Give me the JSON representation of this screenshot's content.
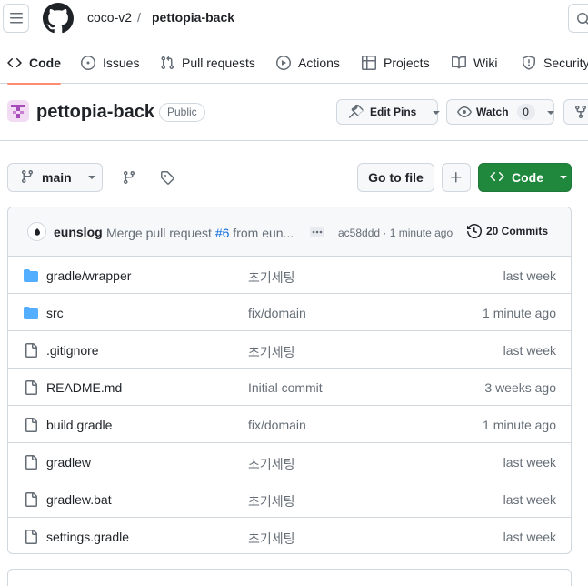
{
  "header": {
    "owner": "coco-v2",
    "separator": "/",
    "repo": "pettopia-back"
  },
  "nav": {
    "tabs": [
      {
        "label": "Code",
        "icon": "code-icon",
        "selected": true
      },
      {
        "label": "Issues",
        "icon": "issue-opened-icon"
      },
      {
        "label": "Pull requests",
        "icon": "git-pull-request-icon"
      },
      {
        "label": "Actions",
        "icon": "play-icon"
      },
      {
        "label": "Projects",
        "icon": "table-icon"
      },
      {
        "label": "Wiki",
        "icon": "book-icon"
      },
      {
        "label": "Security",
        "icon": "shield-icon"
      }
    ]
  },
  "repo": {
    "name": "pettopia-back",
    "visibility": "Public",
    "edit_pins_label": "Edit Pins",
    "watch_label": "Watch",
    "watch_count": "0"
  },
  "file_nav": {
    "branch": "main",
    "go_to_file": "Go to file",
    "code_label": "Code"
  },
  "latest_commit": {
    "author": "eunslog",
    "message_prefix": "Merge pull request ",
    "pr_ref": "#6",
    "message_suffix": " from eun...",
    "sha": "ac58ddd",
    "separator": "·",
    "time": "1 minute ago",
    "commits_label": "20 Commits"
  },
  "files": [
    {
      "type": "folder",
      "name": "gradle/wrapper",
      "message": "초기세팅",
      "date": "last week"
    },
    {
      "type": "folder",
      "name": "src",
      "message": "fix/domain",
      "date": "1 minute ago"
    },
    {
      "type": "file",
      "name": ".gitignore",
      "message": "초기세팅",
      "date": "last week"
    },
    {
      "type": "file",
      "name": "README.md",
      "message": "Initial commit",
      "date": "3 weeks ago"
    },
    {
      "type": "file",
      "name": "build.gradle",
      "message": "fix/domain",
      "date": "1 minute ago"
    },
    {
      "type": "file",
      "name": "gradlew",
      "message": "초기세팅",
      "date": "last week"
    },
    {
      "type": "file",
      "name": "gradlew.bat",
      "message": "초기세팅",
      "date": "last week"
    },
    {
      "type": "file",
      "name": "settings.gradle",
      "message": "초기세팅",
      "date": "last week"
    }
  ],
  "colors": {
    "accent_tab": "#fd8c73",
    "primary_green": "#1f883d",
    "folder_blue": "#54aeff",
    "link_blue": "#0969da",
    "muted": "#656d76",
    "border": "#d0d7de"
  }
}
